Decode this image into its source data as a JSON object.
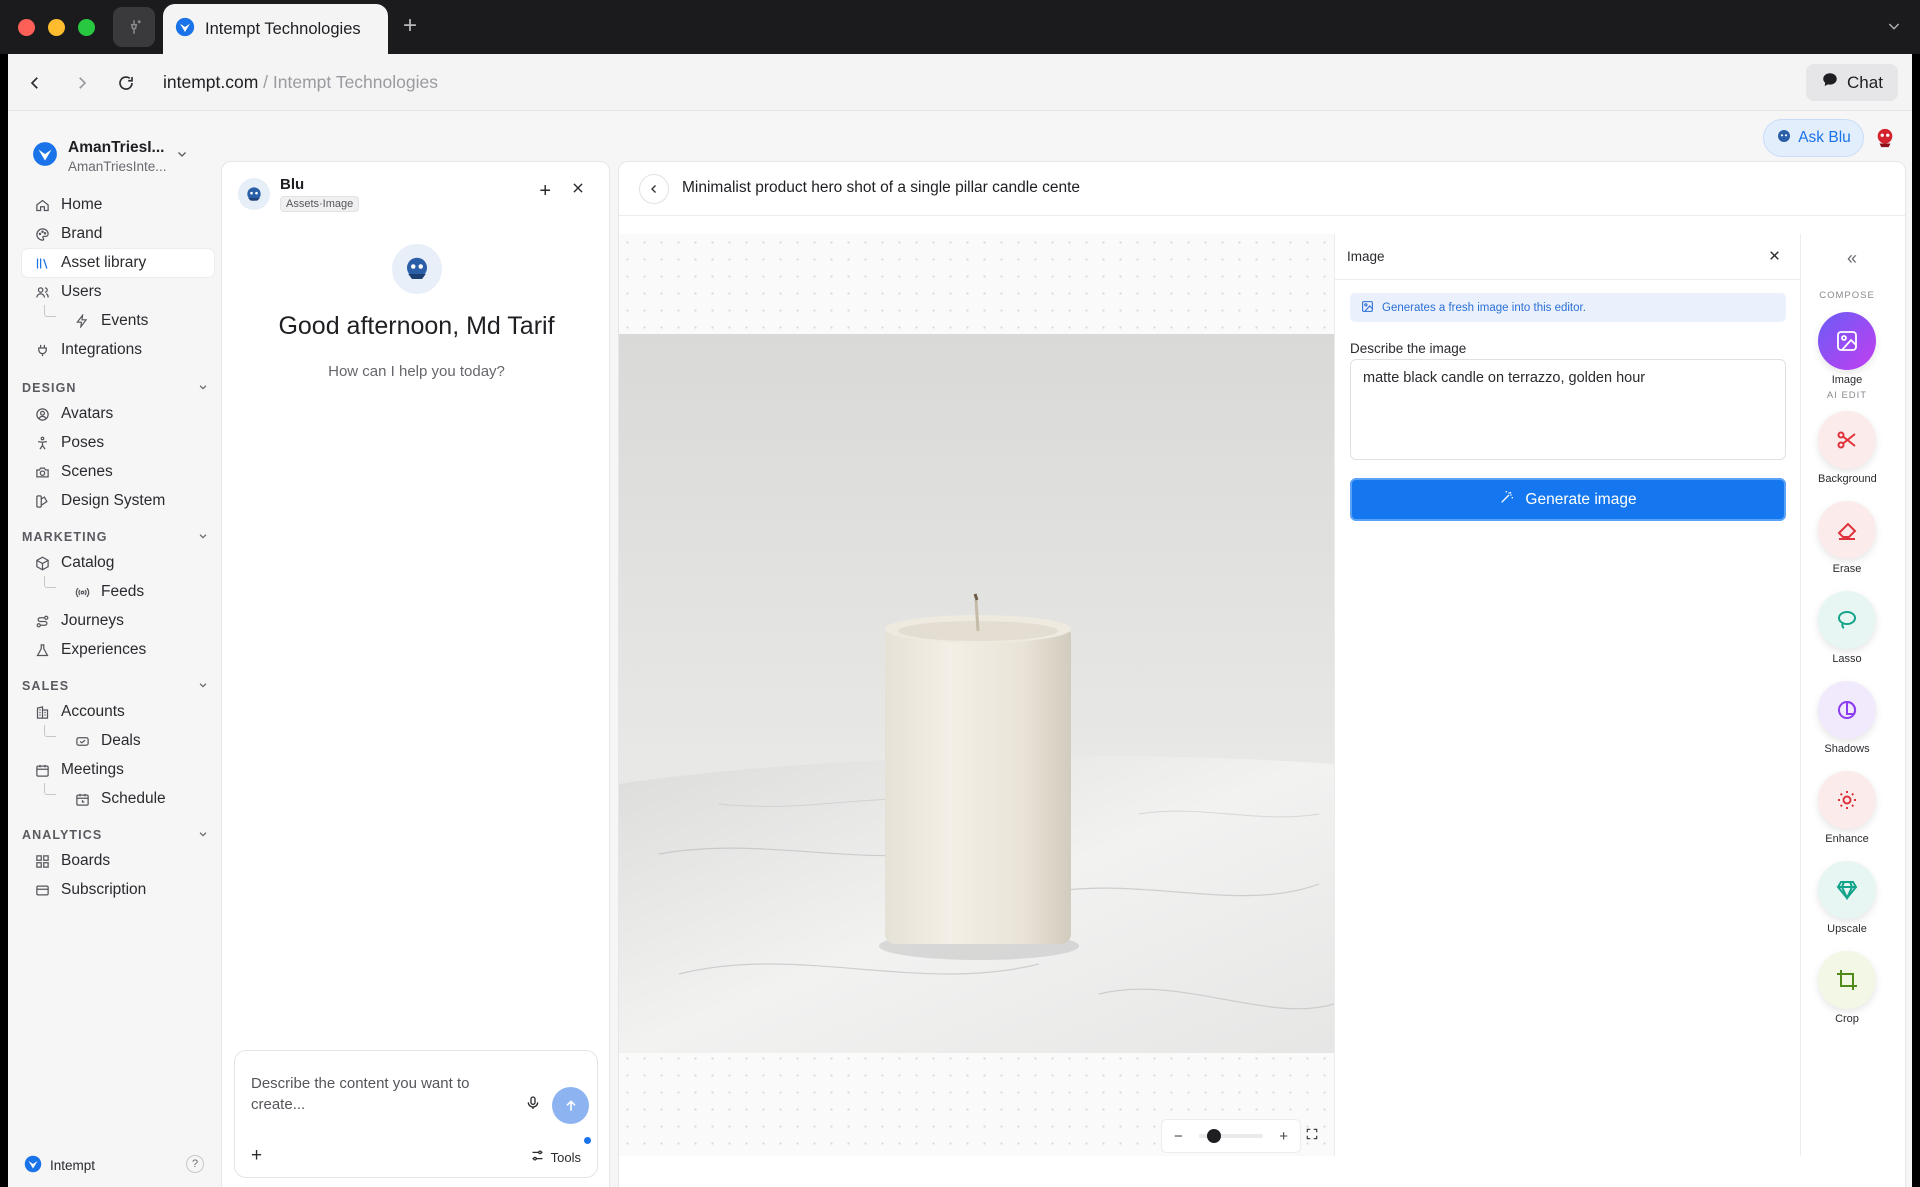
{
  "browser": {
    "tab_title": "Intempt Technologies",
    "url_host": "intempt.com",
    "url_sep": " / ",
    "url_path": "Intempt Technologies",
    "chat_label": "Chat"
  },
  "sidebar": {
    "workspace_name": "AmanTriesI...",
    "workspace_sub": "AmanTriesInte...",
    "top_items": [
      {
        "label": "Home",
        "icon": "home-icon"
      },
      {
        "label": "Brand",
        "icon": "palette-icon"
      },
      {
        "label": "Asset library",
        "icon": "library-icon"
      },
      {
        "label": "Users",
        "icon": "users-icon"
      },
      {
        "label": "Events",
        "icon": "bolt-icon"
      },
      {
        "label": "Integrations",
        "icon": "plug-icon"
      }
    ],
    "sections": [
      {
        "title": "DESIGN",
        "items": [
          "Avatars",
          "Poses",
          "Scenes",
          "Design System"
        ]
      },
      {
        "title": "MARKETING",
        "items": [
          "Catalog",
          "Feeds",
          "Journeys",
          "Experiences"
        ]
      },
      {
        "title": "SALES",
        "items": [
          "Accounts",
          "Deals",
          "Meetings",
          "Schedule"
        ]
      },
      {
        "title": "ANALYTICS",
        "items": [
          "Boards",
          "Subscription"
        ]
      }
    ],
    "footer_label": "Intempt",
    "footer_help": "?"
  },
  "header": {
    "ask_blu_label": "Ask Blu"
  },
  "chat": {
    "assistant_name": "Blu",
    "context_tag": "Assets·Image",
    "greeting": "Good afternoon, Md Tarif",
    "subtitle": "How can I help you today?",
    "composer_placeholder": "Describe the content you want to create...",
    "tools_label": "Tools"
  },
  "editor": {
    "title": "Minimalist product hero shot of a single pillar candle cente",
    "panel_title": "Image",
    "info_text": "Generates a fresh image into this editor.",
    "describe_label": "Describe the image",
    "prompt_value": "matte black candle on terrazzo, golden hour",
    "generate_label": "Generate image",
    "zoom_level": 0.15
  },
  "rail": {
    "compose_label": "COMPOSE",
    "ai_edit_label": "AI EDIT",
    "tools": [
      {
        "label": "Image",
        "icon": "image-icon",
        "color": "#a445f2"
      },
      {
        "label": "Background",
        "icon": "scissors-icon",
        "color": "#e0323c"
      },
      {
        "label": "Erase",
        "icon": "eraser-icon",
        "color": "#e0323c"
      },
      {
        "label": "Lasso",
        "icon": "lasso-icon",
        "color": "#14a38b"
      },
      {
        "label": "Shadows",
        "icon": "shadow-icon",
        "color": "#8b3df0"
      },
      {
        "label": "Enhance",
        "icon": "sun-icon",
        "color": "#e0323c"
      },
      {
        "label": "Upscale",
        "icon": "gem-icon",
        "color": "#14a38b"
      },
      {
        "label": "Crop",
        "icon": "crop-icon",
        "color": "#4f8a1a"
      }
    ]
  },
  "colors": {
    "accent": "#1477f0",
    "active_bg": "#ffffff",
    "info_bg": "#eaf1fc"
  }
}
